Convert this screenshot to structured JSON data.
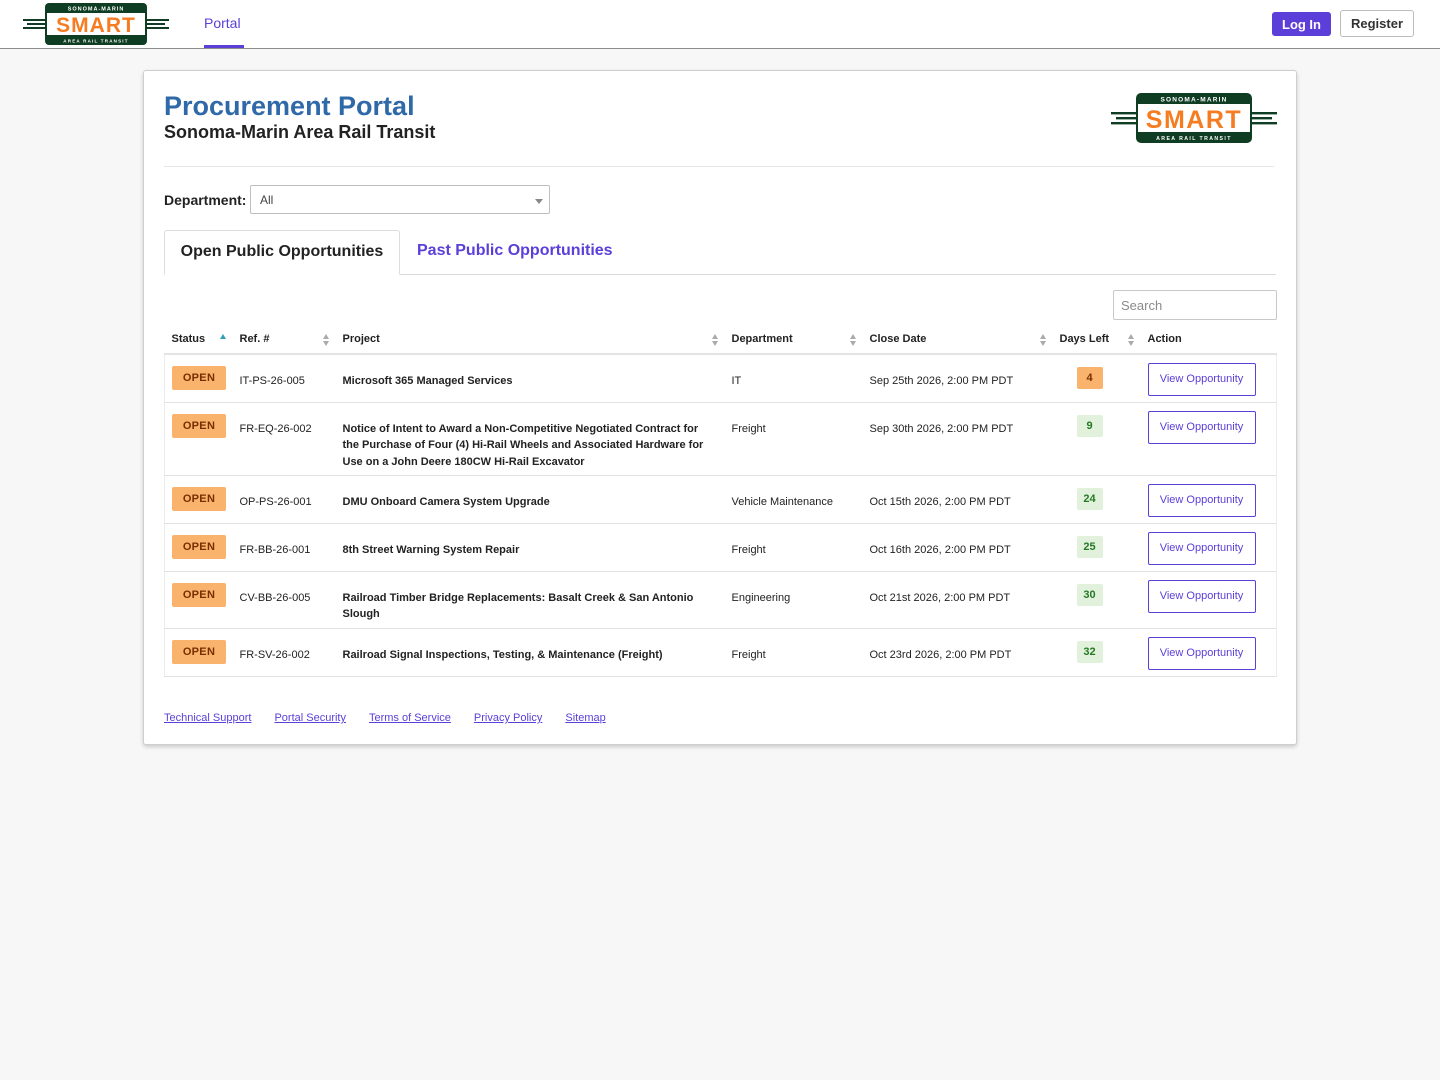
{
  "brand": {
    "logo_top": "SONOMA-MARIN",
    "logo_main": "SMART",
    "logo_bottom": "AREA RAIL TRANSIT",
    "colors": {
      "orange": "#f57c20",
      "green": "#0f3d23",
      "accent": "#5b3fd8"
    }
  },
  "nav": {
    "portal_label": "Portal",
    "login_label": "Log In",
    "register_label": "Register"
  },
  "header": {
    "title": "Procurement Portal",
    "subtitle": "Sonoma-Marin Area Rail Transit"
  },
  "filter": {
    "label": "Department:",
    "selected": "All"
  },
  "tabs": [
    {
      "label": "Open Public Opportunities",
      "active": true
    },
    {
      "label": "Past Public Opportunities",
      "active": false
    }
  ],
  "search": {
    "placeholder": "Search"
  },
  "table": {
    "columns": [
      "Status",
      "Ref. #",
      "Project",
      "Department",
      "Close Date",
      "Days Left",
      "Action"
    ],
    "sort": {
      "column": "Status",
      "direction": "ascending"
    },
    "rows": [
      {
        "status": "OPEN",
        "ref": "IT-PS-26-005",
        "project": "Microsoft 365 Managed Services",
        "department": "IT",
        "close_date": "Sep 25th 2026, 2:00 PM PDT",
        "days_left": "4",
        "action": "View Opportunity"
      },
      {
        "status": "OPEN",
        "ref": "FR-EQ-26-002",
        "project": "Notice of Intent to Award a Non-Competitive Negotiated Contract for the Purchase of Four (4) Hi-Rail Wheels and Associated Hardware for Use on a John Deere 180CW Hi-Rail Excavator",
        "department": "Freight",
        "close_date": "Sep 30th 2026, 2:00 PM PDT",
        "days_left": "9",
        "action": "View Opportunity"
      },
      {
        "status": "OPEN",
        "ref": "OP-PS-26-001",
        "project": "DMU Onboard Camera System Upgrade",
        "department": "Vehicle Maintenance",
        "close_date": "Oct 15th 2026, 2:00 PM PDT",
        "days_left": "24",
        "action": "View Opportunity"
      },
      {
        "status": "OPEN",
        "ref": "FR-BB-26-001",
        "project": "8th Street Warning System Repair",
        "department": "Freight",
        "close_date": "Oct 16th 2026, 2:00 PM PDT",
        "days_left": "25",
        "action": "View Opportunity"
      },
      {
        "status": "OPEN",
        "ref": "CV-BB-26-005",
        "project": "Railroad Timber Bridge Replacements: Basalt Creek & San Antonio Slough",
        "department": "Engineering",
        "close_date": "Oct 21st 2026, 2:00 PM PDT",
        "days_left": "30",
        "action": "View Opportunity"
      },
      {
        "status": "OPEN",
        "ref": "FR-SV-26-002",
        "project": "Railroad Signal Inspections, Testing, & Maintenance (Freight)",
        "department": "Freight",
        "close_date": "Oct 23rd 2026, 2:00 PM PDT",
        "days_left": "32",
        "action": "View Opportunity"
      }
    ]
  },
  "footer": {
    "links": [
      "Technical Support",
      "Portal Security",
      "Terms of Service",
      "Privacy Policy",
      "Sitemap"
    ]
  }
}
